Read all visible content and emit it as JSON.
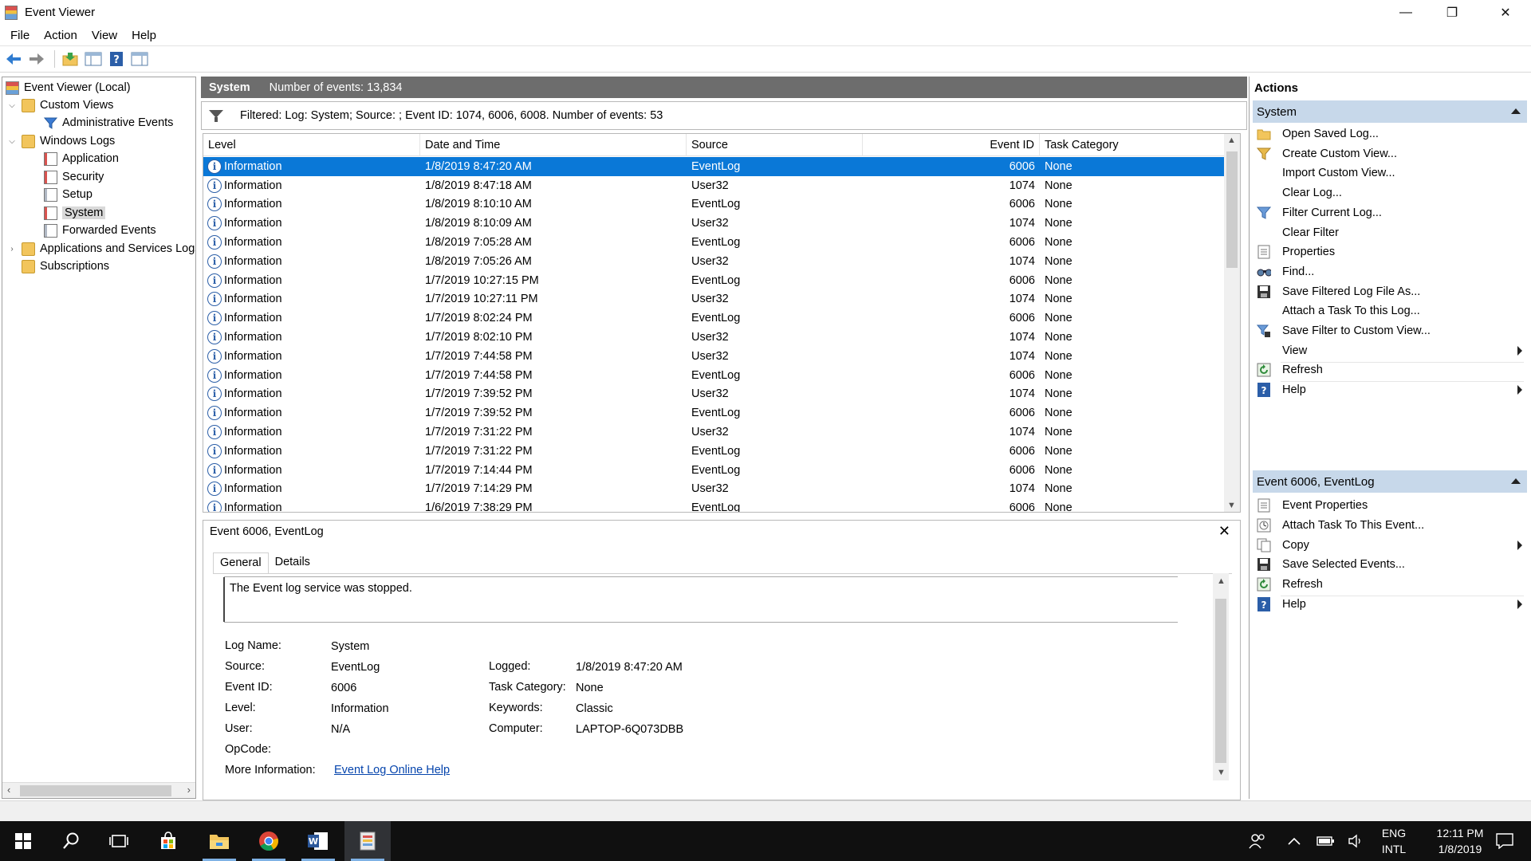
{
  "window": {
    "title": "Event Viewer",
    "controls": {
      "minimize": "—",
      "maximize": "❐",
      "close": "✕"
    }
  },
  "menu": [
    "File",
    "Action",
    "View",
    "Help"
  ],
  "toolbar": [
    "back-icon",
    "forward-icon",
    "open-folder-icon",
    "show-hide-tree-icon",
    "help-icon",
    "show-hide-action-pane-icon"
  ],
  "tree": {
    "items": [
      {
        "label": "Event Viewer (Local)",
        "icon": "event-viewer-icon"
      },
      {
        "label": "Custom Views",
        "icon": "folder-icon"
      },
      {
        "label": "Administrative Events",
        "icon": "filter-icon"
      },
      {
        "label": "Windows Logs",
        "icon": "folder-icon"
      },
      {
        "label": "Application",
        "icon": "log-icon"
      },
      {
        "label": "Security",
        "icon": "log-icon"
      },
      {
        "label": "Setup",
        "icon": "log-icon"
      },
      {
        "label": "System",
        "icon": "log-icon"
      },
      {
        "label": "Forwarded Events",
        "icon": "log-icon"
      },
      {
        "label": "Applications and Services Logs",
        "icon": "folder-icon"
      },
      {
        "label": "Subscriptions",
        "icon": "folder-icon"
      }
    ],
    "selected": "System"
  },
  "center": {
    "log_name": "System",
    "event_count": "Number of events: 13,834",
    "filter_text": "Filtered: Log: System; Source: ; Event ID: 1074, 6006, 6008. Number of events: 53"
  },
  "table": {
    "columns": [
      "Level",
      "Date and Time",
      "Source",
      "Event ID",
      "Task Category"
    ],
    "rows": [
      {
        "level": "Information",
        "date": "1/8/2019 8:47:20 AM",
        "source": "EventLog",
        "id": "6006",
        "task": "None"
      },
      {
        "level": "Information",
        "date": "1/8/2019 8:47:18 AM",
        "source": "User32",
        "id": "1074",
        "task": "None"
      },
      {
        "level": "Information",
        "date": "1/8/2019 8:10:10 AM",
        "source": "EventLog",
        "id": "6006",
        "task": "None"
      },
      {
        "level": "Information",
        "date": "1/8/2019 8:10:09 AM",
        "source": "User32",
        "id": "1074",
        "task": "None"
      },
      {
        "level": "Information",
        "date": "1/8/2019 7:05:28 AM",
        "source": "EventLog",
        "id": "6006",
        "task": "None"
      },
      {
        "level": "Information",
        "date": "1/8/2019 7:05:26 AM",
        "source": "User32",
        "id": "1074",
        "task": "None"
      },
      {
        "level": "Information",
        "date": "1/7/2019 10:27:15 PM",
        "source": "EventLog",
        "id": "6006",
        "task": "None"
      },
      {
        "level": "Information",
        "date": "1/7/2019 10:27:11 PM",
        "source": "User32",
        "id": "1074",
        "task": "None"
      },
      {
        "level": "Information",
        "date": "1/7/2019 8:02:24 PM",
        "source": "EventLog",
        "id": "6006",
        "task": "None"
      },
      {
        "level": "Information",
        "date": "1/7/2019 8:02:10 PM",
        "source": "User32",
        "id": "1074",
        "task": "None"
      },
      {
        "level": "Information",
        "date": "1/7/2019 7:44:58 PM",
        "source": "User32",
        "id": "1074",
        "task": "None"
      },
      {
        "level": "Information",
        "date": "1/7/2019 7:44:58 PM",
        "source": "EventLog",
        "id": "6006",
        "task": "None"
      },
      {
        "level": "Information",
        "date": "1/7/2019 7:39:52 PM",
        "source": "User32",
        "id": "1074",
        "task": "None"
      },
      {
        "level": "Information",
        "date": "1/7/2019 7:39:52 PM",
        "source": "EventLog",
        "id": "6006",
        "task": "None"
      },
      {
        "level": "Information",
        "date": "1/7/2019 7:31:22 PM",
        "source": "User32",
        "id": "1074",
        "task": "None"
      },
      {
        "level": "Information",
        "date": "1/7/2019 7:31:22 PM",
        "source": "EventLog",
        "id": "6006",
        "task": "None"
      },
      {
        "level": "Information",
        "date": "1/7/2019 7:14:44 PM",
        "source": "EventLog",
        "id": "6006",
        "task": "None"
      },
      {
        "level": "Information",
        "date": "1/7/2019 7:14:29 PM",
        "source": "User32",
        "id": "1074",
        "task": "None"
      },
      {
        "level": "Information",
        "date": "1/6/2019 7:38:29 PM",
        "source": "EventLog",
        "id": "6006",
        "task": "None"
      }
    ],
    "selected_index": 0
  },
  "details": {
    "title": "Event 6006, EventLog",
    "close": "✕",
    "tabs": [
      "General",
      "Details"
    ],
    "description": "The Event log service was stopped.",
    "log_name_label": "Log Name:",
    "log_name": "System",
    "source_label": "Source:",
    "source": "EventLog",
    "event_id_label": "Event ID:",
    "event_id": "6006",
    "level_label": "Level:",
    "level": "Information",
    "user_label": "User:",
    "user": "N/A",
    "opcode_label": "OpCode:",
    "opcode": "",
    "more_info_label": "More Information:",
    "more_info_link": "Event Log Online Help",
    "logged_label": "Logged:",
    "logged": "1/8/2019 8:47:20 AM",
    "task_category_label": "Task Category:",
    "task_category": "None",
    "keywords_label": "Keywords:",
    "keywords": "Classic",
    "computer_label": "Computer:",
    "computer": "LAPTOP-6Q073DBB"
  },
  "actions": {
    "title": "Actions",
    "section1": {
      "title": "System",
      "items": [
        {
          "label": "Open Saved Log...",
          "icon": "open-log-icon"
        },
        {
          "label": "Create Custom View...",
          "icon": "create-filter-icon"
        },
        {
          "label": "Import Custom View...",
          "icon": ""
        },
        {
          "label": "Clear Log...",
          "icon": ""
        },
        {
          "label": "Filter Current Log...",
          "icon": "filter-icon"
        },
        {
          "label": "Clear Filter",
          "icon": ""
        },
        {
          "label": "Properties",
          "icon": "properties-icon"
        },
        {
          "label": "Find...",
          "icon": "find-icon"
        },
        {
          "label": "Save Filtered Log File As...",
          "icon": "save-icon"
        },
        {
          "label": "Attach a Task To this Log...",
          "icon": ""
        },
        {
          "label": "Save Filter to Custom View...",
          "icon": "save-filter-icon"
        },
        {
          "label": "View",
          "icon": ""
        },
        {
          "label": "Refresh",
          "icon": "refresh-icon"
        },
        {
          "label": "Help",
          "icon": "help-icon"
        }
      ]
    },
    "section2": {
      "title": "Event 6006, EventLog",
      "items": [
        {
          "label": "Event Properties",
          "icon": "properties-icon"
        },
        {
          "label": "Attach Task To This Event...",
          "icon": "task-icon"
        },
        {
          "label": "Copy",
          "icon": "copy-icon"
        },
        {
          "label": "Save Selected Events...",
          "icon": "save-icon"
        },
        {
          "label": "Refresh",
          "icon": "refresh-icon"
        },
        {
          "label": "Help",
          "icon": "help-icon"
        }
      ]
    }
  },
  "taskbar": {
    "apps": [
      "start-icon",
      "search-icon",
      "task-view-icon",
      "store-icon",
      "file-explorer-icon",
      "chrome-icon",
      "word-icon",
      "event-viewer-icon"
    ],
    "tray": {
      "lang1": "ENG",
      "lang2": "INTL",
      "time": "12:11 PM",
      "date": "1/8/2019"
    }
  },
  "colors": {
    "selection": "#0a78d7",
    "header": "#6d6d6d",
    "section": "#c7d8ea",
    "taskbar": "#101010"
  }
}
